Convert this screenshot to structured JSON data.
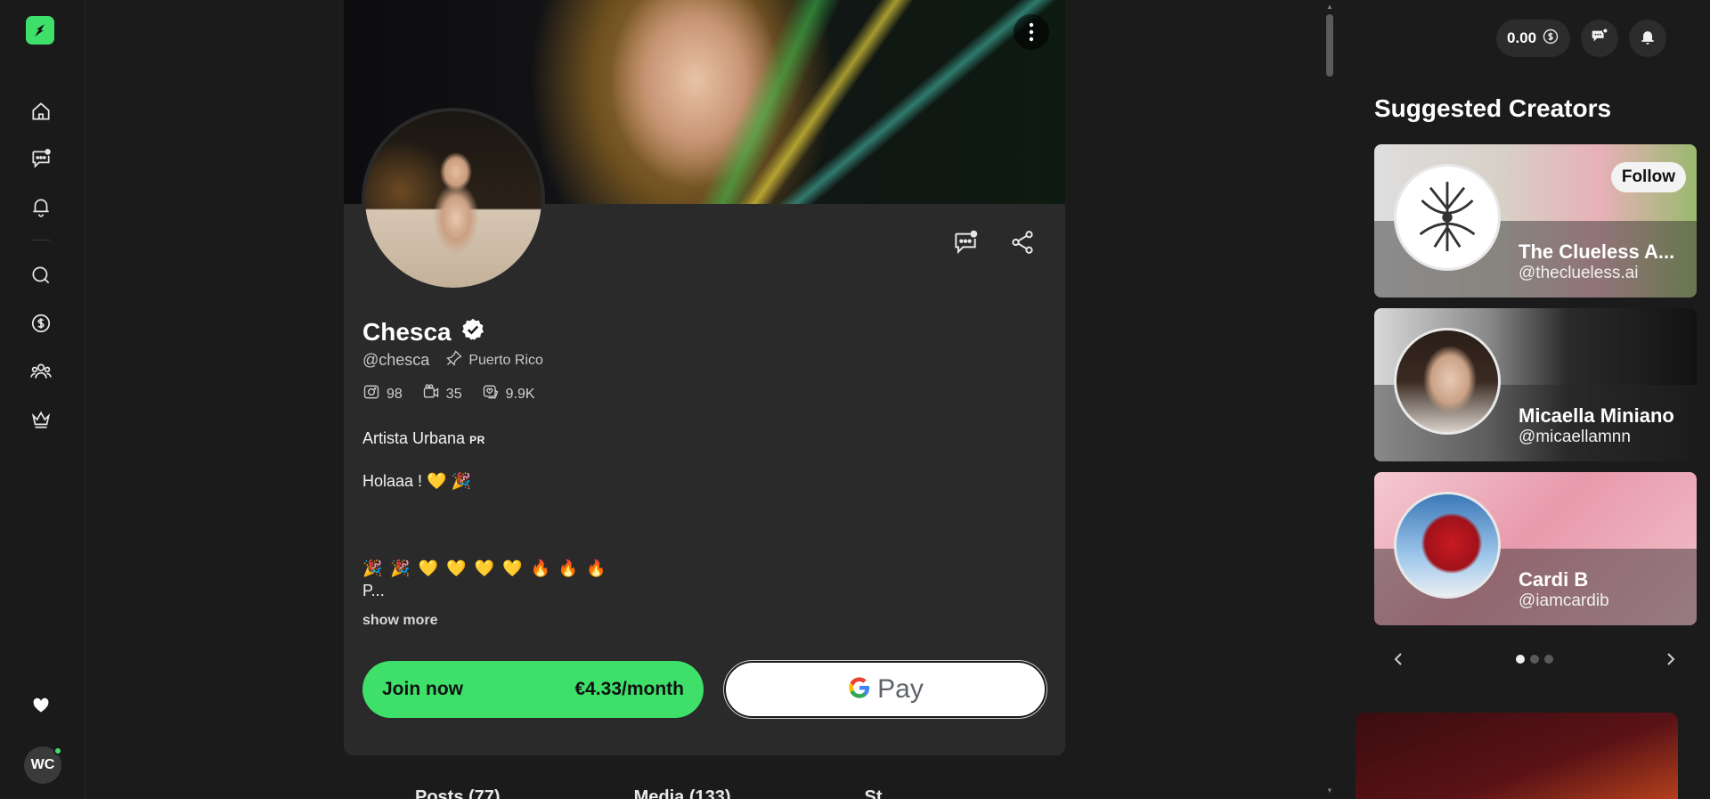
{
  "rail": {
    "items": [
      "home",
      "messages",
      "notifications",
      "search",
      "wallet",
      "creators",
      "premium"
    ],
    "avatar_initials": "WC"
  },
  "profile": {
    "name": "Chesca",
    "handle": "@chesca",
    "location": "Puerto Rico",
    "stats": {
      "photos": "98",
      "videos": "35",
      "likes": "9.9K"
    },
    "bio_line1": "Artista Urbana",
    "bio_line1_tag": "PR",
    "bio_line2": "Holaaa ! 💛 🎉",
    "bio_emojis": "🎉 🎉 💛 💛 💛 💛 🔥 🔥 🔥",
    "bio_trunc": "P...",
    "show_more": "show more",
    "join_label": "Join now",
    "join_price": "€4.33/month",
    "gpay_g": "G",
    "gpay_pay": "Pay",
    "tabs": [
      "Posts (77)",
      "Media (133)",
      "St..."
    ]
  },
  "topbar": {
    "balance": "0.00"
  },
  "suggested": {
    "title": "Suggested Creators",
    "follow_label": "Follow",
    "creators": [
      {
        "name": "The Clueless A...",
        "handle": "@theclueless.ai"
      },
      {
        "name": "Micaella Miniano",
        "handle": "@micaellamnn"
      },
      {
        "name": "Cardi B",
        "handle": "@iamcardib"
      }
    ],
    "carousel_pages": 3,
    "active_page": 1
  },
  "colors": {
    "accent": "#3ee06a",
    "bg": "#1b1b1b",
    "card": "#2a2a2a"
  }
}
